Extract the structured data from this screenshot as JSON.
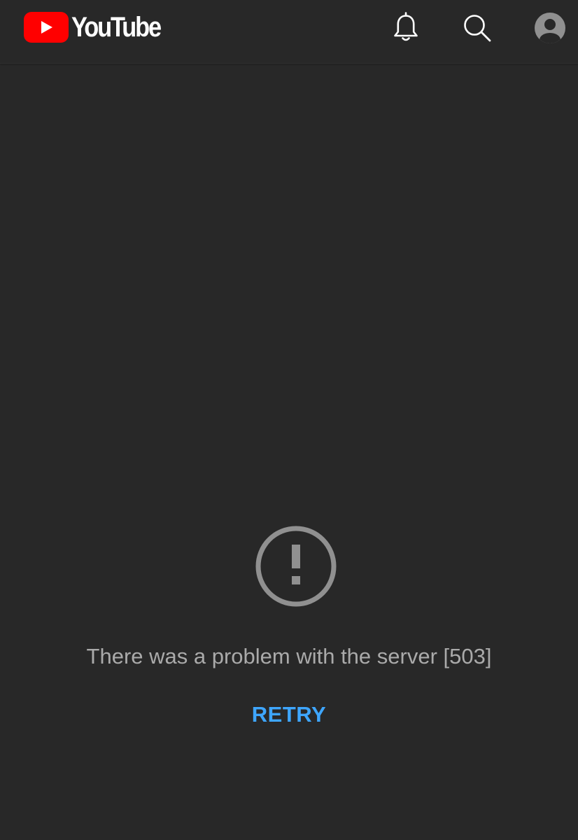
{
  "header": {
    "logo_text": "YouTube",
    "icons": {
      "logo": "youtube-play-logo-icon",
      "notifications": "bell-icon",
      "search": "search-icon",
      "account": "account-avatar-icon"
    }
  },
  "error": {
    "icon": "exclamation-circle-icon",
    "message": "There was a problem with the server [503]",
    "retry_label": "RETRY"
  },
  "colors": {
    "background": "#282828",
    "logo_red": "#ff0000",
    "text_secondary": "#aaaaaa",
    "icon_gray": "#909090",
    "accent_blue": "#3ea6ff"
  }
}
